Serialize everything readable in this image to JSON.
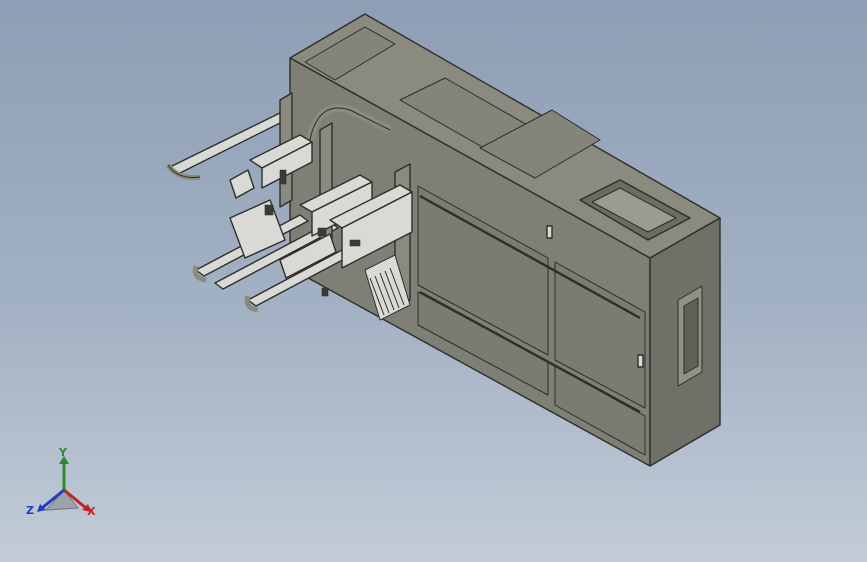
{
  "scene": {
    "kind": "cad-isometric-view",
    "background_top": "#8e9eb4",
    "background_bottom": "#c2ccd7",
    "body_colors": {
      "top": "#8a8a7e",
      "front": "#7f8075",
      "side": "#6f7067",
      "edge": "#2e2e2a",
      "parts": "#d9dad5"
    }
  },
  "triad": {
    "x_label": "X",
    "y_label": "Y",
    "z_label": "Z",
    "x_color": "#c42222",
    "y_color": "#2b8a2b",
    "z_color": "#1f3fbf"
  }
}
